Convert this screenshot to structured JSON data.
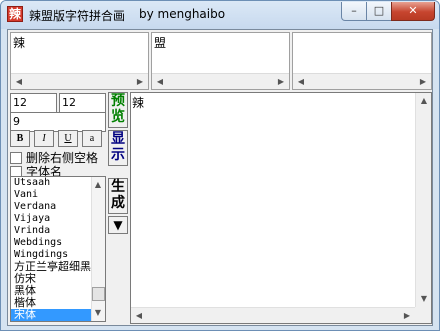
{
  "window": {
    "title": "辣盟版字符拼合画",
    "author": "by menghaibo",
    "app_icon_glyph": "辣",
    "minimize_glyph": "–",
    "maximize_glyph": "□",
    "close_glyph": "✕"
  },
  "panes": [
    "辣",
    "盟",
    ""
  ],
  "inputs": {
    "size_a": "12",
    "size_b": "12",
    "size_c": "9"
  },
  "format_buttons": [
    "B",
    "I",
    "U",
    "a"
  ],
  "options": {
    "trim_right_spaces": "删除右侧空格",
    "font_name": "字体名"
  },
  "font_list": [
    "Utsaah",
    "Vani",
    "Verdana",
    "Vijaya",
    "Vrinda",
    "Webdings",
    "Wingdings",
    "方正兰亭超细黑",
    "仿宋",
    "黑体",
    "楷体",
    "宋体"
  ],
  "selected_font": "宋体",
  "side_buttons": {
    "preview": "预览",
    "display": "显示",
    "generate": "生成",
    "down_glyph": "▼"
  },
  "preview_text": "辣",
  "colors": {
    "preview_button": "#008000",
    "display_button": "#000080",
    "selection": "#3399ff"
  }
}
